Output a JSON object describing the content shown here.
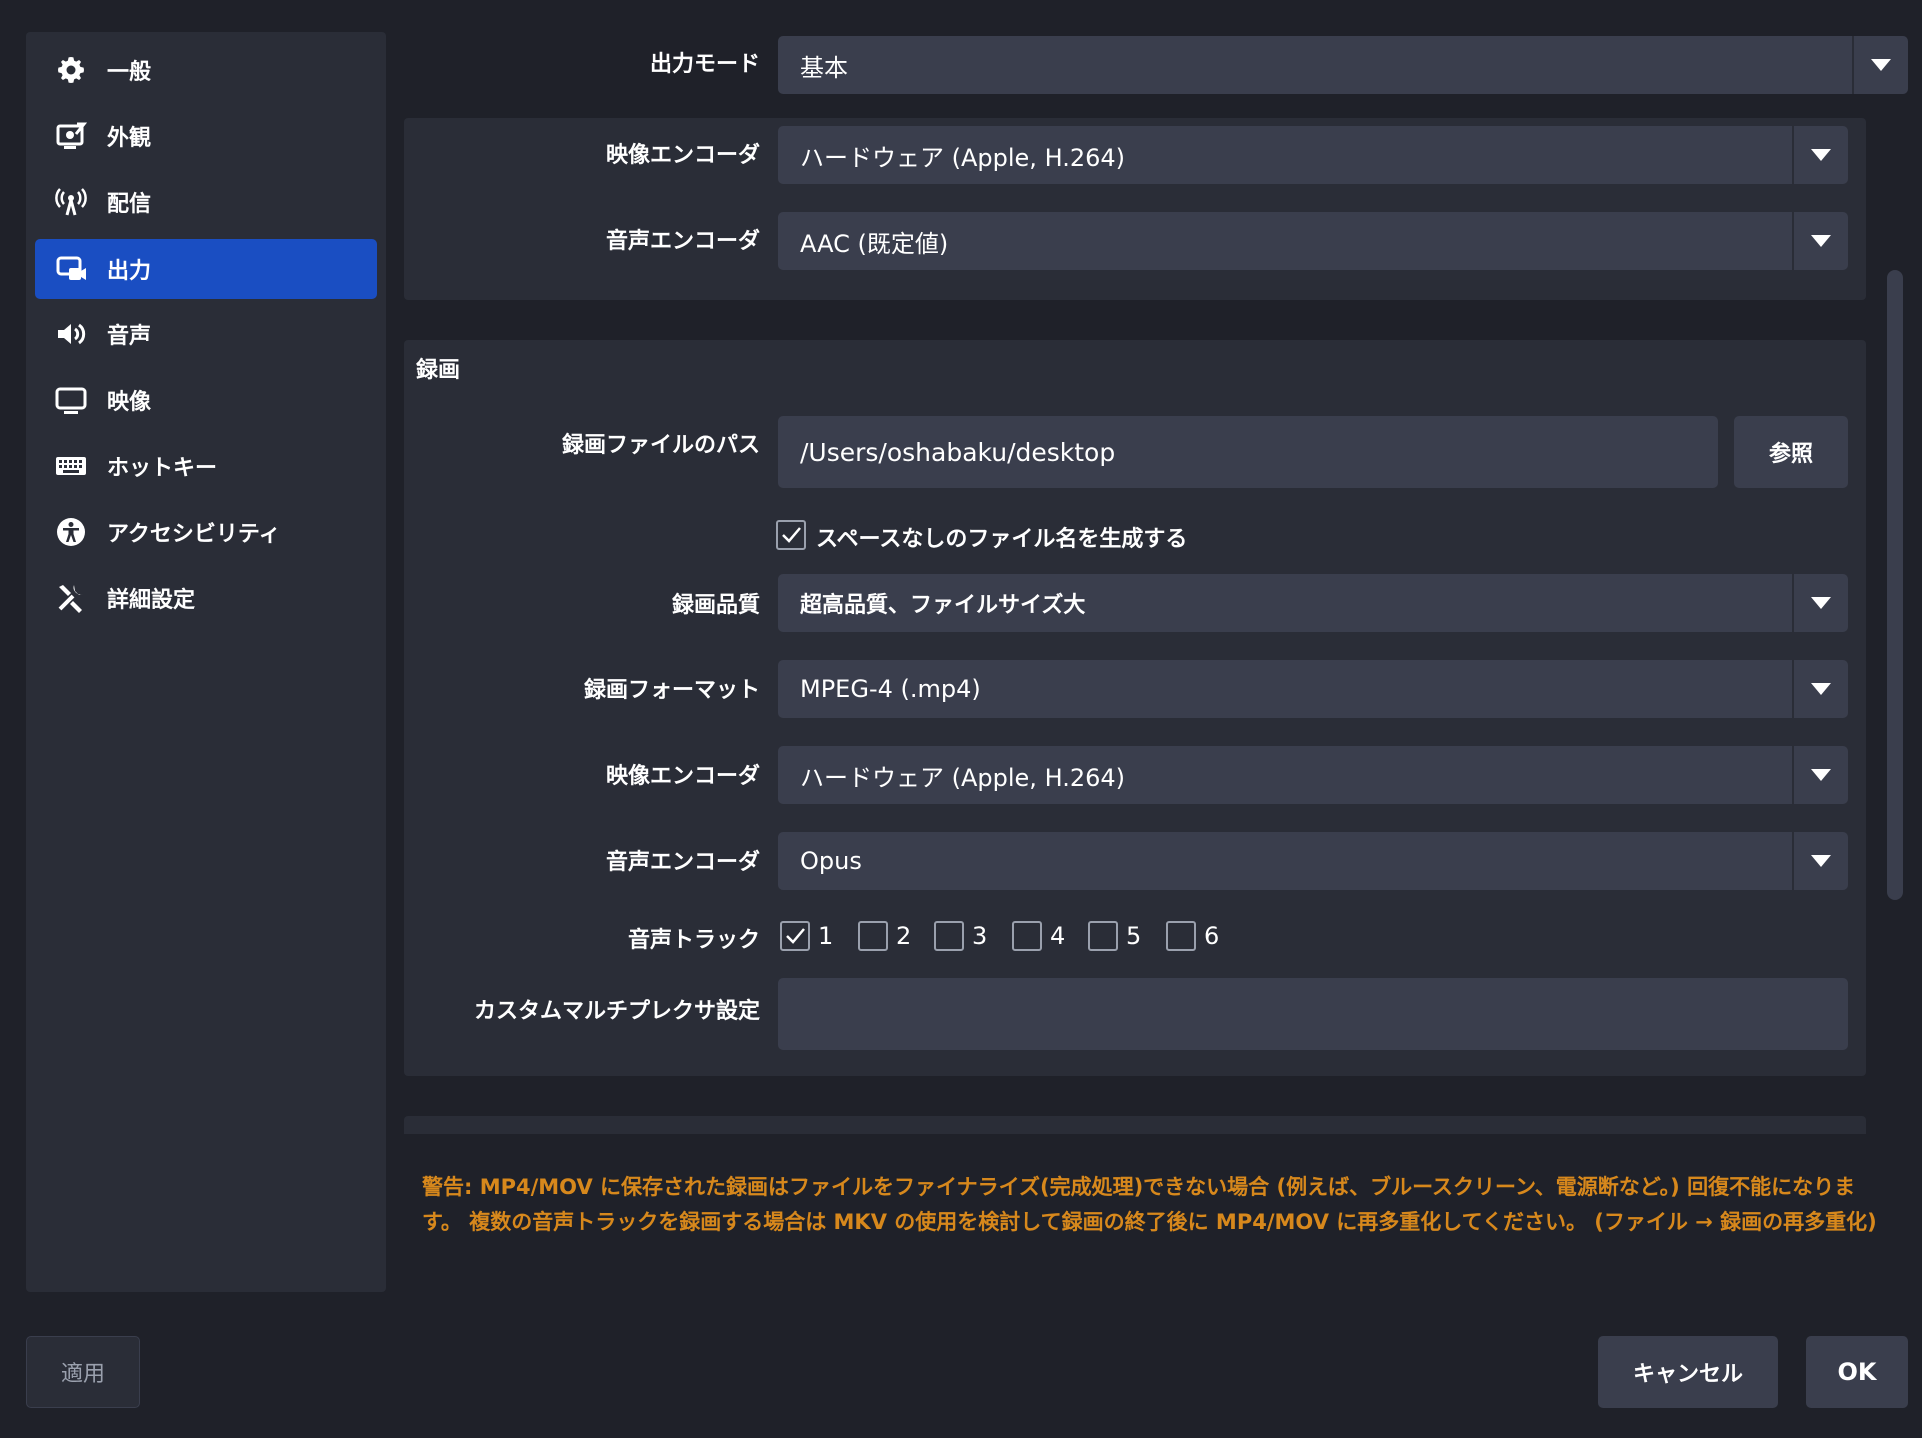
{
  "sidebar": {
    "items": [
      {
        "label": "一般",
        "icon": "gear-icon",
        "active": false
      },
      {
        "label": "外観",
        "icon": "appearance-icon",
        "active": false
      },
      {
        "label": "配信",
        "icon": "broadcast-antenna-icon",
        "active": false
      },
      {
        "label": "出力",
        "icon": "output-icon",
        "active": true
      },
      {
        "label": "音声",
        "icon": "speaker-icon",
        "active": false
      },
      {
        "label": "映像",
        "icon": "monitor-icon",
        "active": false
      },
      {
        "label": "ホットキー",
        "icon": "keyboard-icon",
        "active": false
      },
      {
        "label": "アクセシビリティ",
        "icon": "accessibility-icon",
        "active": false
      },
      {
        "label": "詳細設定",
        "icon": "tools-icon",
        "active": false
      }
    ]
  },
  "output_mode": {
    "label": "出力モード",
    "value": "基本"
  },
  "streaming": {
    "video_encoder": {
      "label": "映像エンコーダ",
      "value": "ハードウェア (Apple, H.264)"
    },
    "audio_encoder": {
      "label": "音声エンコーダ",
      "value": "AAC (既定値)"
    }
  },
  "recording": {
    "title": "録画",
    "path": {
      "label": "録画ファイルのパス",
      "value": "/Users/oshabaku/desktop",
      "browse": "参照"
    },
    "no_space": {
      "label": "スペースなしのファイル名を生成する",
      "checked": true
    },
    "quality": {
      "label": "録画品質",
      "value": "超高品質、ファイルサイズ大"
    },
    "format": {
      "label": "録画フォーマット",
      "value": "MPEG-4 (.mp4)"
    },
    "video_encoder": {
      "label": "映像エンコーダ",
      "value": "ハードウェア (Apple, H.264)"
    },
    "audio_encoder": {
      "label": "音声エンコーダ",
      "value": "Opus"
    },
    "audio_tracks": {
      "label": "音声トラック",
      "tracks": [
        {
          "label": "1",
          "checked": true
        },
        {
          "label": "2",
          "checked": false
        },
        {
          "label": "3",
          "checked": false
        },
        {
          "label": "4",
          "checked": false
        },
        {
          "label": "5",
          "checked": false
        },
        {
          "label": "6",
          "checked": false
        }
      ]
    },
    "muxer": {
      "label": "カスタムマルチプレクサ設定",
      "value": ""
    }
  },
  "warning": "警告: MP4/MOV に保存された録画はファイルをファイナライズ(完成処理)できない場合 (例えば、ブルースクリーン、電源断など。) 回復不能になります。 複数の音声トラックを録画する場合は MKV の使用を検討して録画の終了後に MP4/MOV に再多重化してください。 (ファイル → 録画の再多重化)",
  "footer": {
    "apply": "適用",
    "cancel": "キャンセル",
    "ok": "OK"
  },
  "colors": {
    "accent": "#1a4ec2",
    "warning": "#d7881c",
    "background": "#1f2129",
    "panel": "#2a2d37",
    "control": "#3a3e4d"
  }
}
